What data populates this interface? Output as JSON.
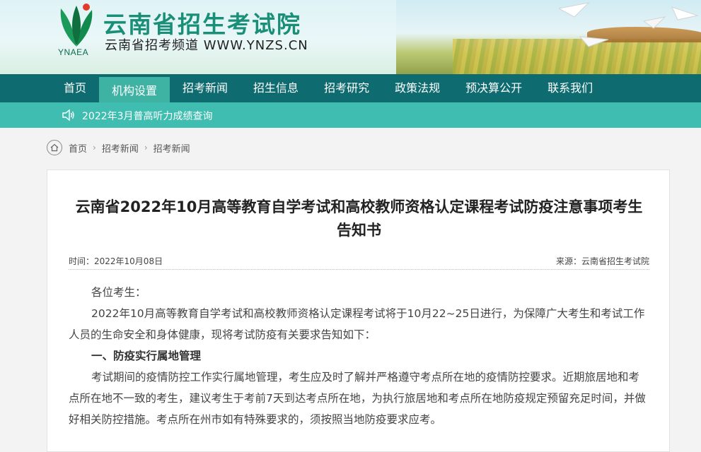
{
  "header": {
    "title": "云南省招生考试院",
    "subtitle": "云南省招考频道  WWW.YNZS.CN",
    "logo_text": "YNAEA",
    "brand_color": "#1a8f78"
  },
  "nav": {
    "items": [
      {
        "label": "首页"
      },
      {
        "label": "机构设置",
        "active": true
      },
      {
        "label": "招考新闻"
      },
      {
        "label": "招生信息"
      },
      {
        "label": "招考研究"
      },
      {
        "label": "政策法规"
      },
      {
        "label": "预决算公开"
      },
      {
        "label": "联系我们"
      }
    ]
  },
  "notice": {
    "icon": "speaker-icon",
    "text": "2022年3月普高听力成绩查询"
  },
  "breadcrumb": {
    "icon": "home-icon",
    "items": [
      "首页",
      "招考新闻",
      "招考新闻"
    ]
  },
  "article": {
    "title": "云南省2022年10月高等教育自学考试和高校教师资格认定课程考试防疫注意事项考生告知书",
    "time": "时间：2022年10月08日",
    "source": "来源：云南省招生考试院",
    "greeting": "各位考生：",
    "p1": "2022年10月高等教育自学考试和高校教师资格认定课程考试将于10月22~25日进行，为保障广大考生和考试工作人员的生命安全和身体健康，现将考试防疫有关要求告知如下：",
    "h1": "一、防疫实行属地管理",
    "p2": "考试期间的疫情防控工作实行属地管理，考生应及时了解并严格遵守考点所在地的疫情防控要求。近期旅居地和考点所在地不一致的考生，建议考生于考前7天到达考点所在地，为执行旅居地和考点所在地防疫规定预留充足时间，并做好相关防控措施。考点所在州市如有特殊要求的，须按照当地防疫要求应考。"
  }
}
